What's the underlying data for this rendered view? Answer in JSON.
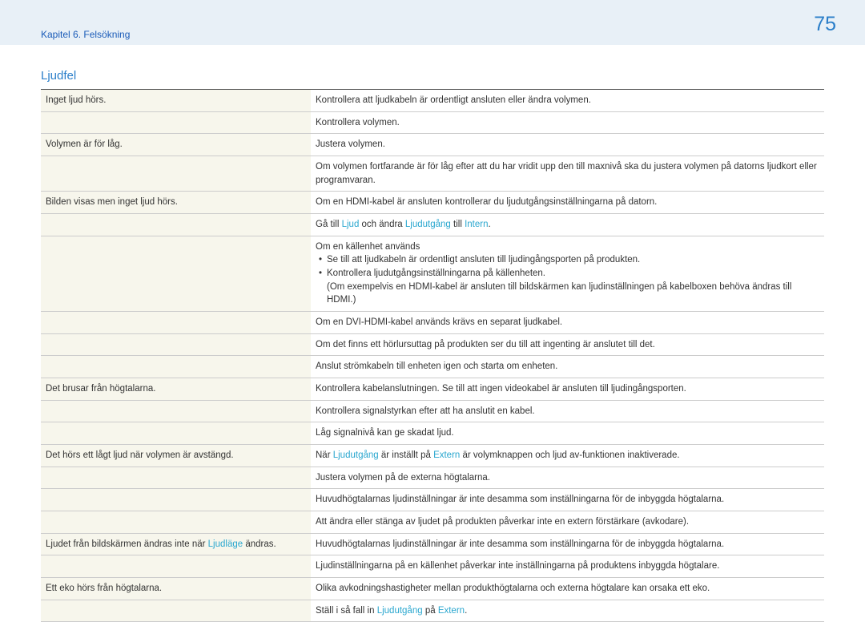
{
  "header": {
    "chapter": "Kapitel 6. Felsökning",
    "page_number": "75"
  },
  "section_title": "Ljudfel",
  "rows": [
    {
      "problem": "Inget ljud hörs.",
      "solution_segments": [
        {
          "text": "Kontrollera att ljudkabeln är ordentligt ansluten eller ändra volymen."
        }
      ]
    },
    {
      "problem": "",
      "solution_segments": [
        {
          "text": "Kontrollera volymen."
        }
      ]
    },
    {
      "problem": "Volymen är för låg.",
      "solution_segments": [
        {
          "text": "Justera volymen."
        }
      ]
    },
    {
      "problem": "",
      "solution_segments": [
        {
          "text": "Om volymen fortfarande är för låg efter att du har vridit upp den till maxnivå ska du justera volymen på datorns ljudkort eller programvaran."
        }
      ]
    },
    {
      "problem": "Bilden visas men inget ljud hörs.",
      "solution_segments": [
        {
          "text": "Om en HDMI-kabel är ansluten kontrollerar du ljudutgångsinställningarna på datorn."
        }
      ]
    },
    {
      "problem": "",
      "solution_segments": [
        {
          "text": "Gå till "
        },
        {
          "text": "Ljud",
          "hl": true
        },
        {
          "text": " och ändra "
        },
        {
          "text": "Ljudutgång",
          "hl": true
        },
        {
          "text": " till "
        },
        {
          "text": "Intern",
          "hl": true
        },
        {
          "text": "."
        }
      ]
    },
    {
      "problem": "",
      "multi": {
        "intro": "Om en källenhet används",
        "bullets": [
          "Se till att ljudkabeln är ordentligt ansluten till ljudingångsporten på produkten.",
          "Kontrollera ljudutgångsinställningarna på källenheten."
        ],
        "note": "(Om exempelvis en HDMI-kabel är ansluten till bildskärmen kan ljudinställningen på kabelboxen behöva ändras till HDMI.)"
      }
    },
    {
      "problem": "",
      "solution_segments": [
        {
          "text": "Om en DVI-HDMI-kabel används krävs en separat ljudkabel."
        }
      ]
    },
    {
      "problem": "",
      "solution_segments": [
        {
          "text": "Om det finns ett hörlursuttag på produkten ser du till att ingenting är anslutet till det."
        }
      ]
    },
    {
      "problem": "",
      "solution_segments": [
        {
          "text": "Anslut strömkabeln till enheten igen och starta om enheten."
        }
      ]
    },
    {
      "problem": "Det brusar från högtalarna.",
      "solution_segments": [
        {
          "text": "Kontrollera kabelanslutningen. Se till att ingen videokabel är ansluten till ljudingångsporten."
        }
      ]
    },
    {
      "problem": "",
      "solution_segments": [
        {
          "text": "Kontrollera signalstyrkan efter att ha anslutit en kabel."
        }
      ]
    },
    {
      "problem": "",
      "solution_segments": [
        {
          "text": "Låg signalnivå kan ge skadat ljud."
        }
      ]
    },
    {
      "problem": "Det hörs ett lågt ljud när volymen är avstängd.",
      "solution_segments": [
        {
          "text": "När "
        },
        {
          "text": "Ljudutgång",
          "hl": true
        },
        {
          "text": " är inställt på "
        },
        {
          "text": "Extern",
          "hl": true
        },
        {
          "text": " är volymknappen och ljud av-funktionen inaktiverade."
        }
      ]
    },
    {
      "problem": "",
      "solution_segments": [
        {
          "text": "Justera volymen på de externa högtalarna."
        }
      ]
    },
    {
      "problem": "",
      "solution_segments": [
        {
          "text": "Huvudhögtalarnas ljudinställningar är inte desamma som inställningarna för de inbyggda högtalarna."
        }
      ]
    },
    {
      "problem": "",
      "solution_segments": [
        {
          "text": "Att ändra eller stänga av ljudet på produkten påverkar inte en extern förstärkare (avkodare)."
        }
      ]
    },
    {
      "problem_segments": [
        {
          "text": "Ljudet från bildskärmen ändras inte när "
        },
        {
          "text": "Ljudläge",
          "hl": true
        },
        {
          "text": " ändras."
        }
      ],
      "solution_segments": [
        {
          "text": "Huvudhögtalarnas ljudinställningar är inte desamma som inställningarna för de inbyggda högtalarna."
        }
      ]
    },
    {
      "problem": "",
      "solution_segments": [
        {
          "text": "Ljudinställningarna på en källenhet påverkar inte inställningarna på produktens inbyggda högtalare."
        }
      ]
    },
    {
      "problem": "Ett eko hörs från högtalarna.",
      "solution_segments": [
        {
          "text": "Olika avkodningshastigheter mellan produkthögtalarna och externa högtalare kan orsaka ett eko."
        }
      ]
    },
    {
      "problem": "",
      "solution_segments": [
        {
          "text": "Ställ i så fall in "
        },
        {
          "text": "Ljudutgång",
          "hl": true
        },
        {
          "text": " på "
        },
        {
          "text": "Extern",
          "hl": true
        },
        {
          "text": "."
        }
      ]
    }
  ]
}
